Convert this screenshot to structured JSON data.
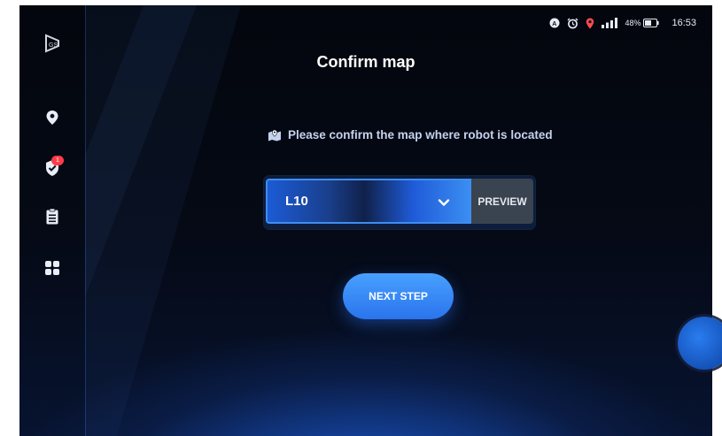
{
  "status_bar": {
    "icons": [
      "a-circle-icon",
      "alarm-clock-icon",
      "location-pin-icon",
      "signal-icon"
    ],
    "battery": "48%",
    "time": "16:53"
  },
  "sidebar": {
    "items": [
      {
        "name": "logo",
        "icon": "brand-logo-icon"
      },
      {
        "name": "location",
        "icon": "location-pin-icon"
      },
      {
        "name": "security",
        "icon": "shield-check-icon",
        "badge": "1"
      },
      {
        "name": "tasks",
        "icon": "clipboard-icon"
      },
      {
        "name": "apps",
        "icon": "apps-grid-icon"
      }
    ]
  },
  "page": {
    "title": "Confirm map",
    "prompt": "Please confirm the map where robot is located",
    "prompt_icon": "map-icon"
  },
  "map_select": {
    "value": "L10",
    "preview_label": "PREVIEW"
  },
  "actions": {
    "next_label": "NEXT STEP"
  },
  "colors": {
    "accent": "#2a74ec",
    "background": "#050a16",
    "badge": "#ff3b4a"
  }
}
